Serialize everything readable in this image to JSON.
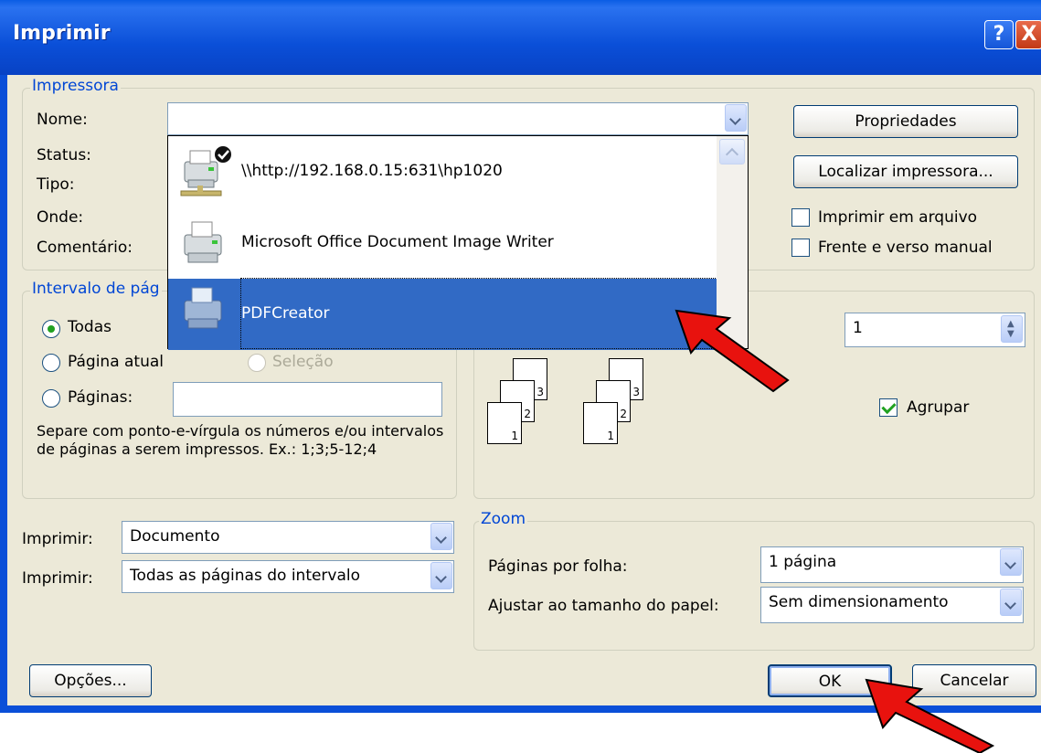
{
  "window": {
    "title": "Imprimir",
    "help": "?",
    "close": "X"
  },
  "printer": {
    "legend": "Impressora",
    "name_label": "Nome:",
    "status_label": "Status:",
    "type_label": "Tipo:",
    "where_label": "Onde:",
    "comment_label": "Comentário:",
    "name_value": "",
    "properties_button": "Propriedades",
    "find_printer_button": "Localizar impressora...",
    "print_to_file": "Imprimir em arquivo",
    "manual_duplex": "Frente e verso manual",
    "dropdown_items": [
      {
        "name": "\\\\http://192.168.0.15:631\\hp1020",
        "icon": "network-printer-default-icon"
      },
      {
        "name": "Microsoft Office Document Image Writer",
        "icon": "printer-icon"
      },
      {
        "name": "PDFCreator",
        "icon": "printer-icon",
        "selected": true
      }
    ]
  },
  "page_range": {
    "legend": "Intervalo de pág",
    "all": "Todas",
    "current_page": "Página atual",
    "selection": "Seleção",
    "pages": "Páginas:",
    "pages_value": "",
    "hint": "Separe com ponto-e-vírgula os números e/ou intervalos de páginas a serem impressos.  Ex.: 1;3;5-12;4"
  },
  "copies": {
    "count": "1",
    "collate": "Agrupar",
    "collate_checked": true,
    "stack_labels": [
      "1",
      "2",
      "3"
    ]
  },
  "print_what": {
    "label1": "Imprimir:",
    "value1": "Documento",
    "label2": "Imprimir:",
    "value2": "Todas as páginas do intervalo"
  },
  "zoom": {
    "legend": "Zoom",
    "pages_per_sheet_label": "Páginas por folha:",
    "pages_per_sheet_value": "1 página",
    "scale_label": "Ajustar ao tamanho do papel:",
    "scale_value": "Sem dimensionamento"
  },
  "footer": {
    "options": "Opções...",
    "ok": "OK",
    "cancel": "Cancelar"
  },
  "colors": {
    "title_bar": "#0a4fd8",
    "selection": "#316ac5",
    "arrow": "#e8120e",
    "group_legend": "#0046d5"
  }
}
